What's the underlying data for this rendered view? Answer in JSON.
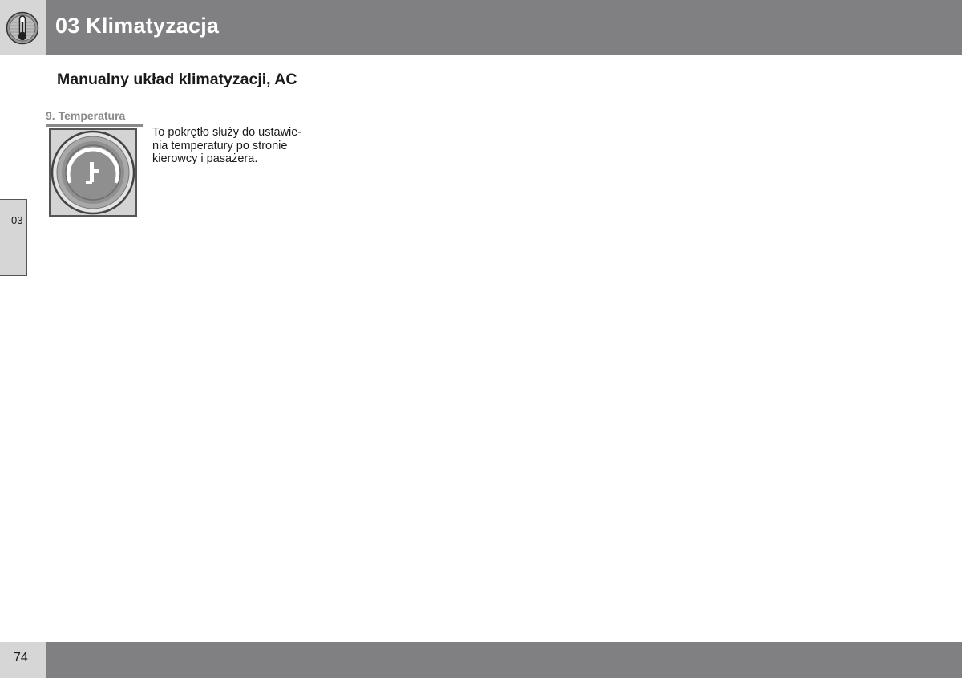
{
  "header": {
    "title": "03 Klimatyzacja",
    "icon": "thermometer-icon"
  },
  "section": {
    "title": "Manualny układ klimatyzacji, AC"
  },
  "side_tab": {
    "label": "03"
  },
  "subsection": {
    "heading": "9. Temperatura",
    "image": "temperature-knob-icon",
    "text_lines": [
      "To pokrętło służy do ustawie-",
      "nia temperatury po stronie",
      "kierowcy i pasażera."
    ]
  },
  "footer": {
    "page_number": "74"
  },
  "colors": {
    "bar": "#808083",
    "tab": "#d6d6d6",
    "heading_grey": "#8a8a8a",
    "text": "#1a1a1a"
  }
}
